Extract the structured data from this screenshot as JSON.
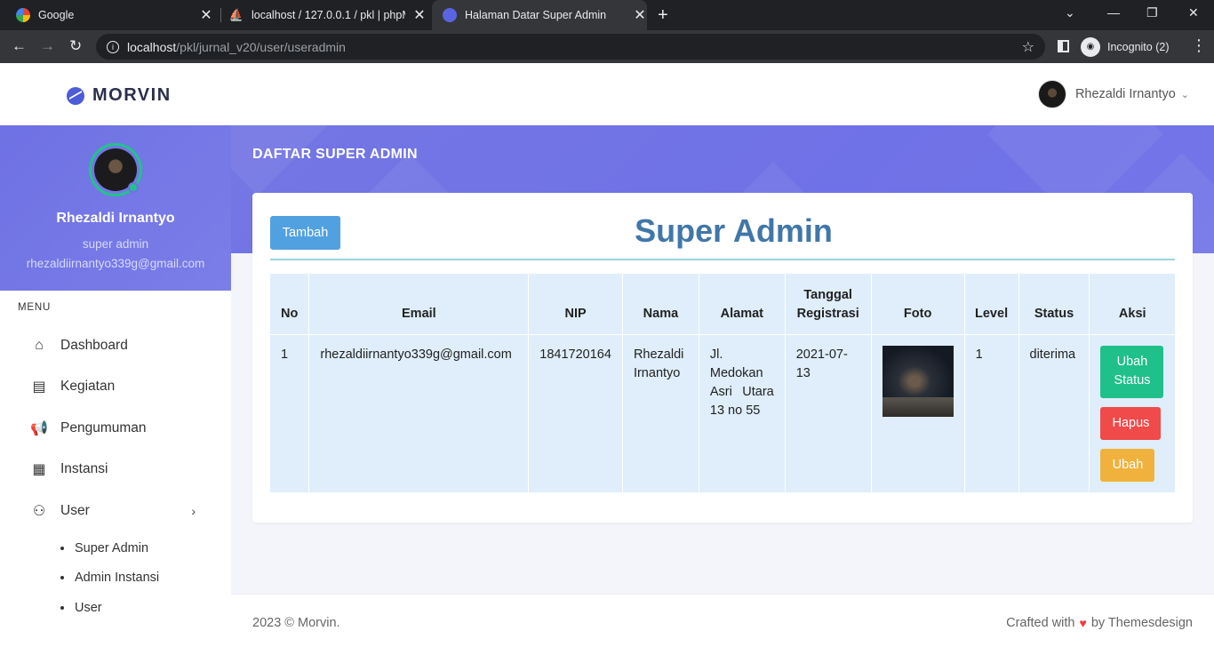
{
  "browser": {
    "tabs": [
      {
        "title": "Google"
      },
      {
        "title": "localhost / 127.0.0.1 / pkl | phpMyA"
      },
      {
        "title": "Halaman Datar Super Admin"
      }
    ],
    "url_host": "localhost",
    "url_path": "/pkl/jurnal_v20/user/useradmin",
    "profile_label": "Incognito (2)"
  },
  "header": {
    "brand": "MORVIN",
    "user_name": "Rhezaldi Irnantyo"
  },
  "sidebar": {
    "profile": {
      "name": "Rhezaldi Irnantyo",
      "role": "super admin",
      "email": "rhezaldiirnantyo339g@gmail.com"
    },
    "menu_title": "MENU",
    "items": [
      {
        "label": "Dashboard",
        "icon": "home-icon"
      },
      {
        "label": "Kegiatan",
        "icon": "clipboard-icon"
      },
      {
        "label": "Pengumuman",
        "icon": "megaphone-icon"
      },
      {
        "label": "Instansi",
        "icon": "store-icon"
      },
      {
        "label": "User",
        "icon": "users-icon"
      }
    ],
    "sub_items": [
      {
        "label": "Super Admin"
      },
      {
        "label": "Admin Instansi"
      },
      {
        "label": "User"
      }
    ]
  },
  "page": {
    "heading": "DAFTAR SUPER ADMIN",
    "card_title": "Super Admin",
    "add_button": "Tambah"
  },
  "table": {
    "columns": [
      "No",
      "Email",
      "NIP",
      "Nama",
      "Alamat",
      "Tanggal Registrasi",
      "Foto",
      "Level",
      "Status",
      "Aksi"
    ],
    "rows": [
      {
        "no": "1",
        "email": "rhezaldiirnantyo339g@gmail.com",
        "nip": "1841720164",
        "nama": "Rhezaldi Irnantyo",
        "alamat": "Jl. Medokan Asri Utara 13 no 55",
        "tanggal": "2021-07-13",
        "level": "1",
        "status": "diterima",
        "actions": {
          "ubah_status": "Ubah Status",
          "hapus": "Hapus",
          "ubah": "Ubah"
        }
      }
    ]
  },
  "footer": {
    "left": "2023 © Morvin.",
    "right_prefix": "Crafted with",
    "right_suffix": "by Themesdesign"
  },
  "colors": {
    "accent": "#7375e6",
    "success": "#1fc08a",
    "danger": "#f04a4a",
    "warning": "#f0b23d",
    "primary": "#51a1e1"
  }
}
